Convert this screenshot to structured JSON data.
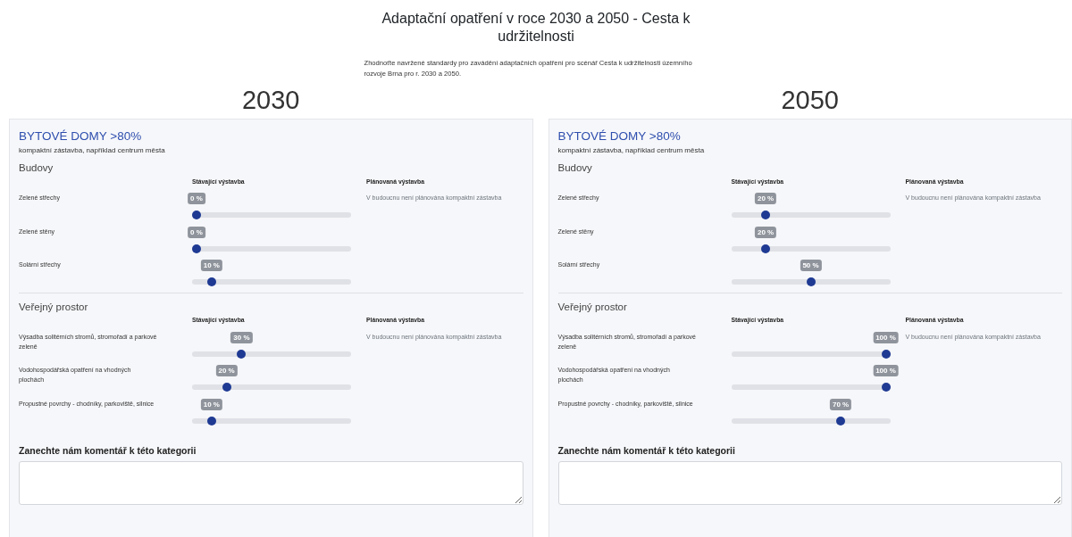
{
  "title": "Adaptační opatření v roce 2030 a 2050 - Cesta k udržitelnosti",
  "description": "Zhodnoťte navržené standardy pro zavádění adaptačních opatření pro scénář Cesta k udržitelnosti územního rozvoje Brna pro r. 2030 a 2050.",
  "columns": [
    {
      "year": "2030",
      "category": {
        "title": "BYTOVÉ DOMY >80%",
        "subtitle": "kompaktní zástavba, například centrum města"
      },
      "sections": [
        {
          "heading": "Budovy",
          "existing_header": "Stávající výstavba",
          "planned_header": "Plánovaná výstavba",
          "planned_note": "V budoucnu není plánována kompaktní zástavba",
          "rows": [
            {
              "label": "Zelené střechy",
              "level": 0,
              "value": "0 %"
            },
            {
              "label": "Zelené stěny",
              "level": 0,
              "value": "0 %"
            },
            {
              "label": "Solární střechy",
              "level": 0.1,
              "value": "10 %"
            }
          ]
        },
        {
          "heading": "Veřejný prostor",
          "existing_header": "Stávající výstavba",
          "planned_header": "Plánovaná výstavba",
          "planned_note": "V budoucnu není plánována kompaktní zástavba",
          "rows": [
            {
              "label": "Výsadba solitérních stromů, stromořadí a parkové zeleně",
              "level": 0.3,
              "value": "30 %"
            },
            {
              "label": "Vodohospodářská opatření na vhodných plochách",
              "level": 0.2,
              "value": "20 %"
            },
            {
              "label": "Propustné povrchy - chodníky, parkoviště, silnice",
              "level": 0.1,
              "value": "10 %"
            }
          ]
        }
      ],
      "comment": {
        "label": "Zanechte nám komentář k této kategorii"
      }
    },
    {
      "year": "2050",
      "category": {
        "title": "BYTOVÉ DOMY >80%",
        "subtitle": "kompaktní zástavba, například centrum města"
      },
      "sections": [
        {
          "heading": "Budovy",
          "existing_header": "Stávající výstavba",
          "planned_header": "Plánovaná výstavba",
          "planned_note": "V budoucnu není plánována kompaktní zástavba",
          "rows": [
            {
              "label": "Zelené střechy",
              "level": 0.2,
              "value": "20 %"
            },
            {
              "label": "Zelené stěny",
              "level": 0.2,
              "value": "20 %"
            },
            {
              "label": "Solární střechy",
              "level": 0.5,
              "value": "50 %"
            }
          ]
        },
        {
          "heading": "Veřejný prostor",
          "existing_header": "Stávající výstavba",
          "planned_header": "Plánovaná výstavba",
          "planned_note": "V budoucnu není plánována kompaktní zástavba",
          "rows": [
            {
              "label": "Výsadba solitérních stromů, stromořadí a parkové zeleně",
              "level": 1,
              "value": "100 %"
            },
            {
              "label": "Vodohospodářská opatření na vhodných plochách",
              "level": 1,
              "value": "100 %"
            },
            {
              "label": "Propustné povrchy - chodníky, parkoviště, silnice",
              "level": 0.7,
              "value": "70 %"
            }
          ]
        }
      ],
      "comment": {
        "label": "Zanechte nám komentář k této kategorii"
      }
    }
  ]
}
